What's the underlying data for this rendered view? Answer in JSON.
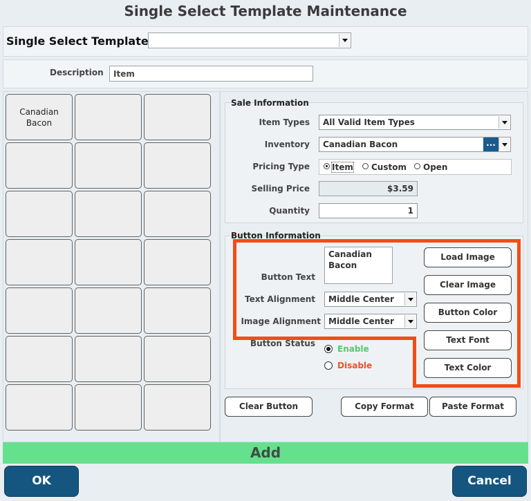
{
  "title": "Single Select Template Maintenance",
  "templates": {
    "label": "Single Select Templates",
    "selected": ""
  },
  "description": {
    "label": "Description",
    "value": "Item"
  },
  "grid": {
    "cells": [
      "Canadian\nBacon",
      "",
      "",
      "",
      "",
      "",
      "",
      "",
      "",
      "",
      "",
      "",
      "",
      "",
      "",
      "",
      "",
      "",
      "",
      "",
      ""
    ]
  },
  "sale_info": {
    "legend": "Sale Information",
    "item_types_label": "Item Types",
    "item_types_value": "All Valid Item Types",
    "inventory_label": "Inventory",
    "inventory_value": "Canadian Bacon",
    "inventory_button": "...",
    "pricing_type_label": "Pricing Type",
    "pricing_options": [
      "Item",
      "Custom",
      "Open"
    ],
    "pricing_selected": "Item",
    "selling_price_label": "Selling Price",
    "selling_price_value": "$3.59",
    "quantity_label": "Quantity",
    "quantity_value": "1"
  },
  "button_info": {
    "legend": "Button Information",
    "button_text_label": "Button Text",
    "button_text_value": "Canadian\nBacon",
    "text_alignment_label": "Text Alignment",
    "text_alignment_value": "Middle Center",
    "image_alignment_label": "Image Alignment",
    "image_alignment_value": "Middle Center",
    "button_status_label": "Button Status",
    "enable_label": "Enable",
    "disable_label": "Disable",
    "status_selected": "Enable",
    "load_image": "Load Image",
    "clear_image": "Clear Image",
    "button_color": "Button Color",
    "text_font": "Text Font",
    "text_color": "Text Color"
  },
  "actions": {
    "clear_button": "Clear Button",
    "copy_format": "Copy Format",
    "paste_format": "Paste Format",
    "add": "Add",
    "ok": "OK",
    "cancel": "Cancel"
  },
  "colors": {
    "highlight": "#f14d14",
    "add_bar": "#65e18e",
    "primary_button": "#145680",
    "enable_text": "#58c86a",
    "disable_text": "#f0502a"
  }
}
